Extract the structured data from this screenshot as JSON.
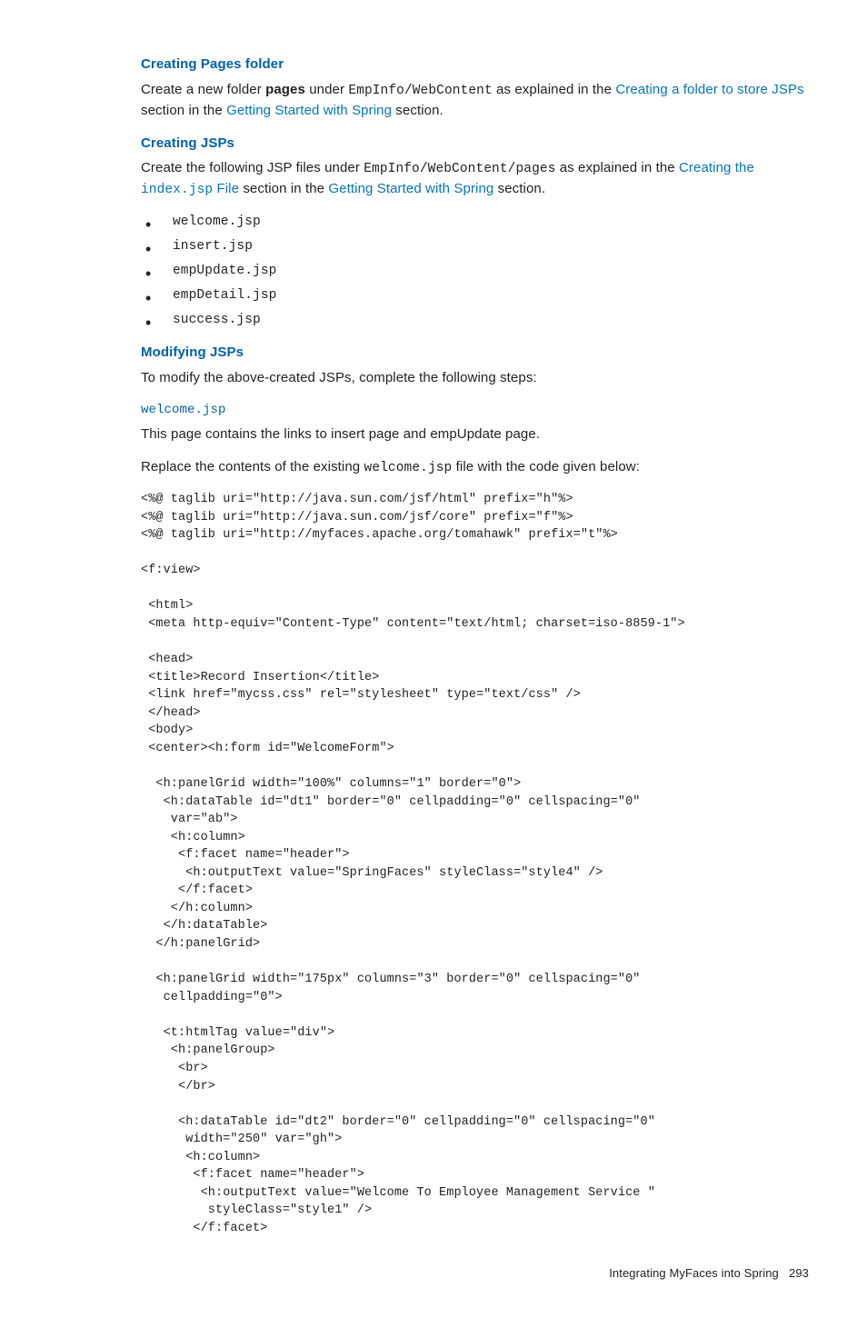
{
  "section1": {
    "heading": "Creating Pages folder",
    "para_parts": {
      "t1": "Create a new folder ",
      "bold": "pages",
      "t2": " under ",
      "mono": "EmpInfo/WebContent",
      "t3": " as explained in the ",
      "link1": "Creating a folder to store JSPs",
      "t4": " section in the ",
      "link2": "Getting Started with Spring",
      "t5": " section."
    }
  },
  "section2": {
    "heading": "Creating JSPs",
    "para_parts": {
      "t1": "Create the following JSP files under ",
      "mono": "EmpInfo/WebContent/pages",
      "t2": " as explained in the ",
      "link1": "Creating the ",
      "link1mono": "index.jsp",
      "link1b": " File",
      "t3": " section in the ",
      "link2": "Getting Started with Spring",
      "t4": " section."
    },
    "items": [
      "welcome.jsp",
      "insert.jsp",
      "empUpdate.jsp",
      "empDetail.jsp",
      "success.jsp"
    ]
  },
  "section3": {
    "heading": "Modifying JSPs",
    "para": "To modify the above-created JSPs, complete the following steps:",
    "subheading": "welcome.jsp",
    "para2": "This page contains the links to insert page and empUpdate page.",
    "para3_parts": {
      "t1": "Replace the contents of the existing ",
      "mono": "welcome.jsp",
      "t2": " file with the code given below:"
    }
  },
  "code": "<%@ taglib uri=\"http://java.sun.com/jsf/html\" prefix=\"h\"%>\n<%@ taglib uri=\"http://java.sun.com/jsf/core\" prefix=\"f\"%>\n<%@ taglib uri=\"http://myfaces.apache.org/tomahawk\" prefix=\"t\"%>\n\n<f:view>\n\n <html>\n <meta http-equiv=\"Content-Type\" content=\"text/html; charset=iso-8859-1\">\n\n <head>\n <title>Record Insertion</title>\n <link href=\"mycss.css\" rel=\"stylesheet\" type=\"text/css\" />\n </head>\n <body>\n <center><h:form id=\"WelcomeForm\">\n\n  <h:panelGrid width=\"100%\" columns=\"1\" border=\"0\">\n   <h:dataTable id=\"dt1\" border=\"0\" cellpadding=\"0\" cellspacing=\"0\"\n    var=\"ab\">\n    <h:column>\n     <f:facet name=\"header\">\n      <h:outputText value=\"SpringFaces\" styleClass=\"style4\" />\n     </f:facet>\n    </h:column>\n   </h:dataTable>\n  </h:panelGrid>\n\n  <h:panelGrid width=\"175px\" columns=\"3\" border=\"0\" cellspacing=\"0\"\n   cellpadding=\"0\">\n\n   <t:htmlTag value=\"div\">\n    <h:panelGroup>\n     <br>\n     </br>\n\n     <h:dataTable id=\"dt2\" border=\"0\" cellpadding=\"0\" cellspacing=\"0\"\n      width=\"250\" var=\"gh\">\n      <h:column>\n       <f:facet name=\"header\">\n        <h:outputText value=\"Welcome To Employee Management Service \"\n         styleClass=\"style1\" />\n       </f:facet>",
  "footer": {
    "text": "Integrating MyFaces into Spring",
    "page": "293"
  }
}
